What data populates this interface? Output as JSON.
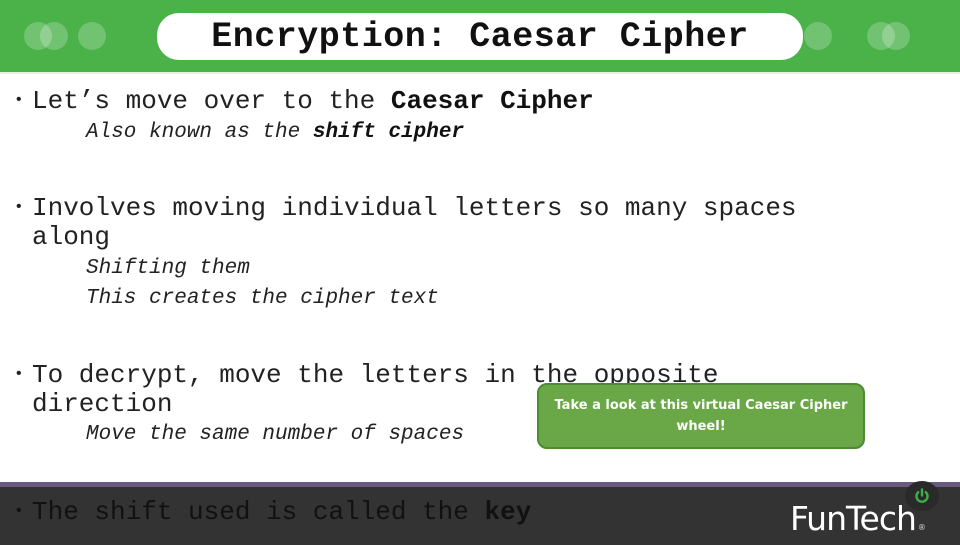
{
  "header": {
    "title": "Encryption: Caesar Cipher",
    "decoration_icon": "overlapping-circles",
    "colors": {
      "header_green": "#4bb24a",
      "pill": "#ffffff"
    }
  },
  "bullets": [
    {
      "text_plain": "Let’s move over to the ",
      "text_bold": "Caesar Cipher",
      "subs": [
        {
          "plain": "Also known as the ",
          "bold": "shift cipher"
        }
      ]
    },
    {
      "line1": "Involves moving individual letters so many spaces",
      "line2": "along",
      "subs": [
        {
          "plain": "Shifting them"
        },
        {
          "plain": "This creates the cipher text"
        }
      ]
    },
    {
      "line1": "To decrypt, move the letters in the opposite",
      "line2": "direction",
      "subs": [
        {
          "plain": "Move the same number of spaces"
        }
      ]
    }
  ],
  "callout": {
    "text": "Take a look at this virtual Caesar Cipher wheel!",
    "color": "#6aa746"
  },
  "footer": {
    "bullet_plain": "The shift used is called the ",
    "bullet_bold": "key",
    "logo_text": "FunTech",
    "logo_reg": "®",
    "power_icon": "power-icon",
    "colors": {
      "bar": "#333333",
      "stripe": "#6b5a80",
      "power": "#3fae49"
    }
  }
}
